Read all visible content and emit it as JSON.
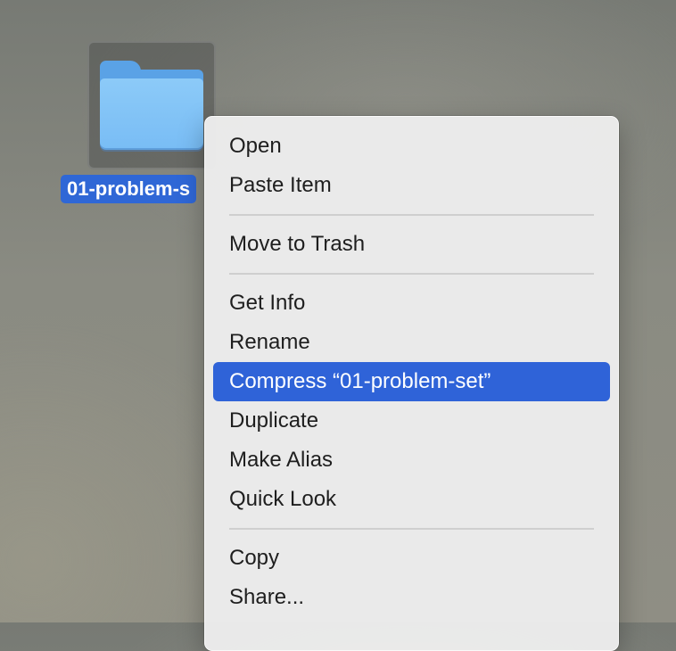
{
  "desktop": {
    "folder_label": "01-problem-s"
  },
  "menu": {
    "group1": [
      "Open",
      "Paste Item"
    ],
    "group2": [
      "Move to Trash"
    ],
    "group3": [
      "Get Info",
      "Rename",
      "Compress “01-problem-set”",
      "Duplicate",
      "Make Alias",
      "Quick Look"
    ],
    "group4": [
      "Copy",
      "Share..."
    ],
    "highlighted_item": "Compress “01-problem-set”"
  },
  "colors": {
    "selection_blue": "#2f63d8",
    "folder_blue": "#79bdf5"
  }
}
